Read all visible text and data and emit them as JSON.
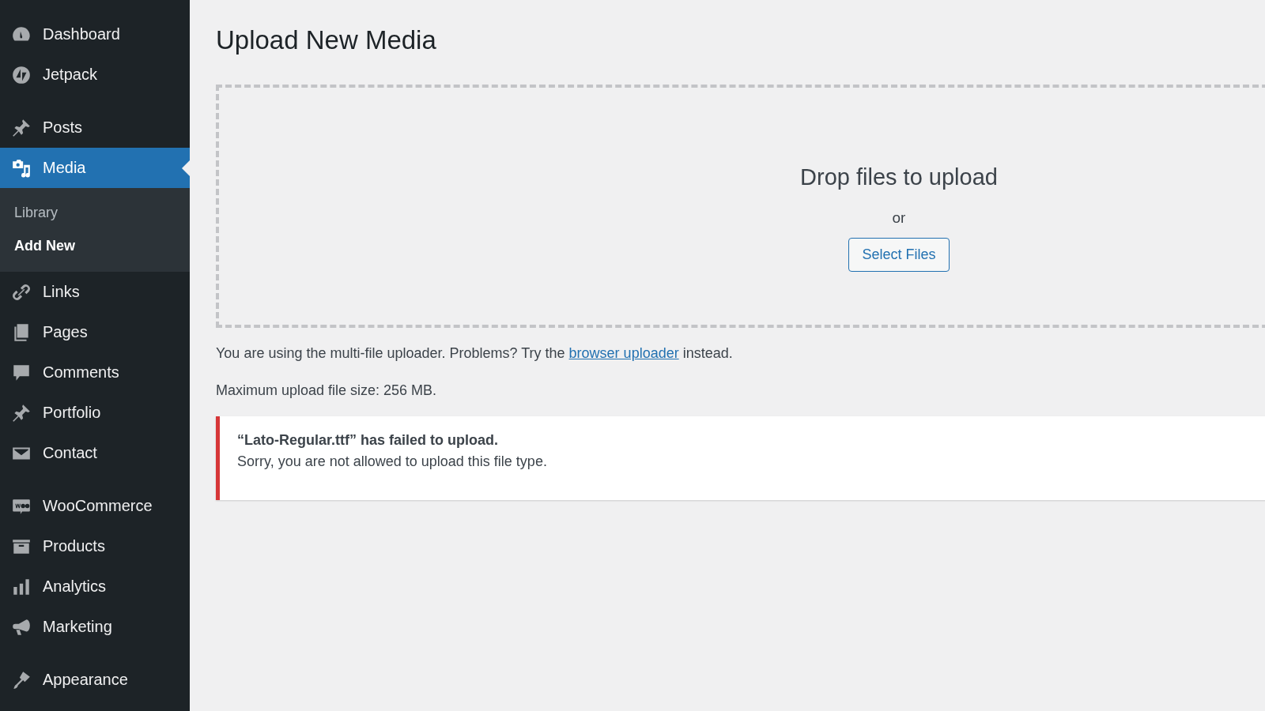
{
  "sidebar": {
    "groups": [
      [
        {
          "label": "Dashboard",
          "kind": "gauge",
          "selected": false
        },
        {
          "label": "Jetpack",
          "kind": "bolt",
          "selected": false
        }
      ],
      [
        {
          "label": "Posts",
          "kind": "pin",
          "selected": false
        },
        {
          "label": "Media",
          "kind": "media",
          "selected": true,
          "children": [
            {
              "label": "Library",
              "selected": false
            },
            {
              "label": "Add New",
              "selected": true
            }
          ]
        },
        {
          "label": "Links",
          "kind": "link",
          "selected": false
        },
        {
          "label": "Pages",
          "kind": "pages",
          "selected": false
        },
        {
          "label": "Comments",
          "kind": "comment",
          "selected": false
        },
        {
          "label": "Portfolio",
          "kind": "pin",
          "selected": false
        },
        {
          "label": "Contact",
          "kind": "mail",
          "selected": false
        }
      ],
      [
        {
          "label": "WooCommerce",
          "kind": "woo",
          "selected": false
        },
        {
          "label": "Products",
          "kind": "box",
          "selected": false
        },
        {
          "label": "Analytics",
          "kind": "bars",
          "selected": false
        },
        {
          "label": "Marketing",
          "kind": "megaphone",
          "selected": false
        }
      ],
      [
        {
          "label": "Appearance",
          "kind": "brush",
          "selected": false
        }
      ]
    ]
  },
  "page": {
    "title": "Upload New Media",
    "dropzone": {
      "heading": "Drop files to upload",
      "or": "or",
      "button": "Select Files"
    },
    "uploader_note": {
      "before": "You are using the multi-file uploader. Problems? Try the ",
      "link": "browser uploader",
      "after": " instead."
    },
    "max_size": "Maximum upload file size: 256 MB.",
    "error": {
      "title": "“Lato-Regular.ttf” has failed to upload.",
      "message": "Sorry, you are not allowed to upload this file type."
    }
  }
}
